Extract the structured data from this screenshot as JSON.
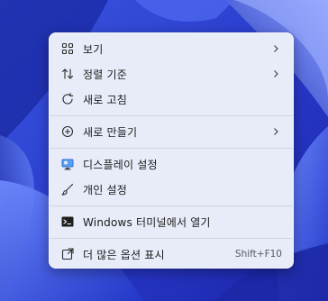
{
  "colors": {
    "menu_background": "#e8ecf8",
    "separator": "#cfd4e2",
    "text": "#1b1b1b",
    "shortcut_text": "#555a66",
    "wallpaper_base": "#2a3fcf"
  },
  "menu": {
    "items": [
      {
        "label": "보기",
        "icon": "grid-view-icon",
        "has_submenu": true
      },
      {
        "label": "정렬 기준",
        "icon": "sort-icon",
        "has_submenu": true
      },
      {
        "label": "새로 고침",
        "icon": "refresh-icon",
        "has_submenu": false
      },
      {
        "label": "새로 만들기",
        "icon": "add-circle-icon",
        "has_submenu": true
      },
      {
        "label": "디스플레이 설정",
        "icon": "display-icon",
        "has_submenu": false
      },
      {
        "label": "개인 설정",
        "icon": "brush-icon",
        "has_submenu": false
      },
      {
        "label": "Windows 터미널에서 열기",
        "icon": "terminal-icon",
        "has_submenu": false
      },
      {
        "label": "더 많은 옵션 표시",
        "icon": "more-options-icon",
        "has_submenu": false,
        "shortcut": "Shift+F10"
      }
    ]
  }
}
